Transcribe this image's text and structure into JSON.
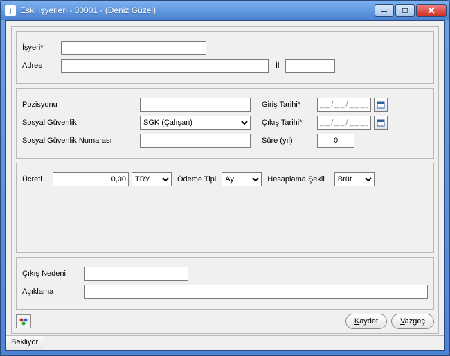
{
  "window": {
    "title": "Eski İşyerleri - 00001 - (Deniz Güzel)",
    "icon_letter": "j"
  },
  "g1": {
    "isyeri_label": "İşyeri*",
    "isyeri_value": "",
    "adres_label": "Adres",
    "adres_value": "",
    "il_label": "İl",
    "il_value": ""
  },
  "g2": {
    "pozisyon_label": "Pozisyonu",
    "pozisyon_value": "",
    "giris_label": "Giriş Tarihi*",
    "giris_value": "__/__/____",
    "sg_label": "Sosyal Güvenlik",
    "sg_value": "SGK (Çalışan)",
    "sg_options": [
      "SGK (Çalışan)"
    ],
    "cikis_label": "Çıkış Tarihi*",
    "cikis_value": "__/__/____",
    "sgn_label": "Sosyal Güvenlik Numarası",
    "sgn_value": "",
    "sure_label": "Süre (yıl)",
    "sure_value": "0"
  },
  "g3": {
    "ucret_label": "Ücreti",
    "ucret_value": "0,00",
    "currency_value": "TRY",
    "currency_options": [
      "TRY"
    ],
    "odeme_label": "Ödeme Tipi",
    "odeme_value": "Ay",
    "odeme_options": [
      "Ay"
    ],
    "hesap_label": "Hesaplama Şekli",
    "hesap_value": "Brüt",
    "hesap_options": [
      "Brüt"
    ]
  },
  "g4": {
    "cikis_nedeni_label": "Çıkış Nedeni",
    "cikis_nedeni_value": "",
    "aciklama_label": "Açıklama",
    "aciklama_value": ""
  },
  "buttons": {
    "save_u": "K",
    "save_rest": "aydet",
    "cancel_u": "V",
    "cancel_rest": "azgeç"
  },
  "status": {
    "text": "Bekliyor"
  }
}
